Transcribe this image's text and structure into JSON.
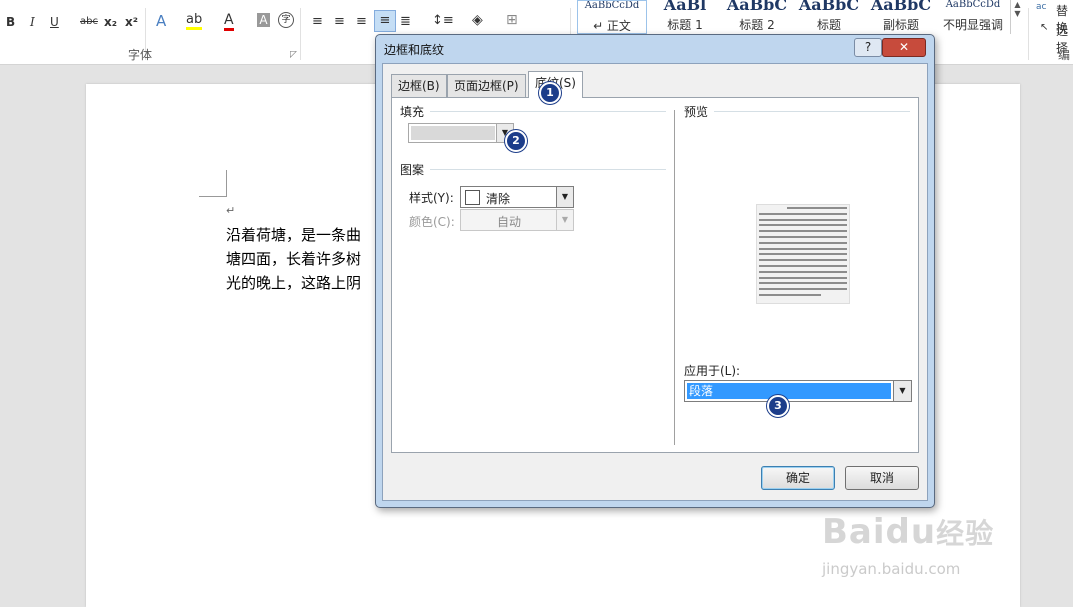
{
  "ribbon": {
    "font_buttons": [
      "B",
      "I",
      "U",
      "abc",
      "x₂",
      "x²"
    ],
    "font_effect_icons": [
      "text-effect-icon",
      "highlight-icon",
      "font-color-icon",
      "shading-char-icon",
      "enclose-char-icon"
    ],
    "font_group_label": "字体",
    "styles": [
      {
        "preview": "AaBbCcDd",
        "name": "↵ 正文"
      },
      {
        "preview": "AaBl",
        "name": "标题 1"
      },
      {
        "preview": "AaBbC",
        "name": "标题 2"
      },
      {
        "preview": "AaBbC",
        "name": "标题"
      },
      {
        "preview": "AaBbC",
        "name": "副标题"
      },
      {
        "preview": "AaBbCcDd",
        "name": "不明显强调"
      }
    ],
    "edit_items": [
      "替换",
      "选择"
    ],
    "edit_group_label": "编辑"
  },
  "document": {
    "para_mark": "↵",
    "lines": [
      "沿着荷塘，是一条曲",
      "塘四面，长着许多树",
      "光的晚上，这路上阴"
    ]
  },
  "dialog": {
    "title": "边框和底纹",
    "help_label": "?",
    "close_label": "✕",
    "tabs": [
      "边框(B)",
      "页面边框(P)",
      "底纹(S)"
    ],
    "fill_section": "填充",
    "pattern_section": "图案",
    "style_label": "样式(Y):",
    "style_value": "清除",
    "color_label": "颜色(C):",
    "color_value": "自动",
    "preview_section": "预览",
    "apply_label": "应用于(L):",
    "apply_value": "段落",
    "ok_label": "确定",
    "cancel_label": "取消",
    "fill_color": "#d9d9d9",
    "apply_highlight_color": "#3399ff"
  },
  "annotations": [
    "1",
    "2",
    "3"
  ],
  "watermark": {
    "brand": "Bai",
    "paw": "du",
    "suffix": "经验",
    "url": "jingyan.baidu.com"
  }
}
